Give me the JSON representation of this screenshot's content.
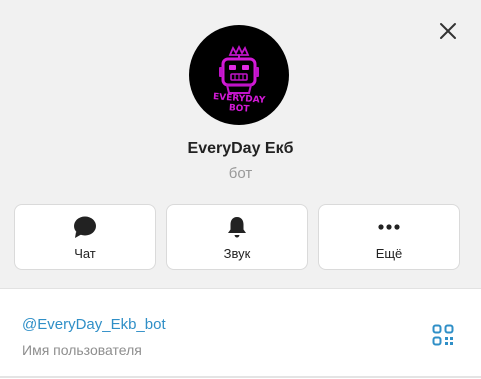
{
  "profile": {
    "name": "EveryDay Екб",
    "subtitle": "бот",
    "avatar_text": "EVERYDAY BOT",
    "avatar_accent": "#c014c9"
  },
  "actions": [
    {
      "label": "Чат",
      "icon": "chat-bubble-icon"
    },
    {
      "label": "Звук",
      "icon": "bell-icon"
    },
    {
      "label": "Ещё",
      "icon": "more-dots-icon"
    }
  ],
  "info": {
    "username": "@EveryDay_Ekb_bot",
    "username_caption": "Имя пользователя",
    "accent": "#2f8fc7"
  }
}
